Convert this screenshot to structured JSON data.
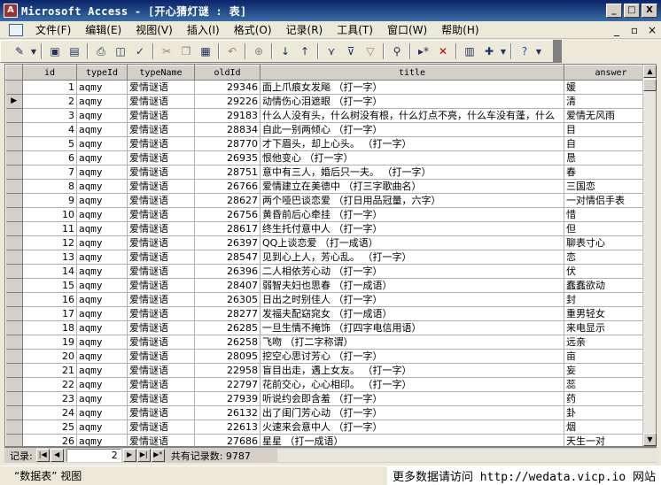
{
  "window": {
    "title": "Microsoft Access - [开心猜灯谜 : 表]",
    "app_icon": "access-key-icon",
    "controls": [
      "_",
      "□",
      "X"
    ]
  },
  "menu": {
    "items": [
      "文件(F)",
      "编辑(E)",
      "视图(V)",
      "插入(I)",
      "格式(O)",
      "记录(R)",
      "工具(T)",
      "窗口(W)",
      "帮助(H)"
    ],
    "doc_controls": [
      "_",
      "▫",
      "×"
    ]
  },
  "toolbar": {
    "icons": [
      "view-icon",
      "save-icon",
      "db-window-icon",
      "print-icon",
      "preview-icon",
      "spell-icon",
      "cut-icon",
      "copy-icon",
      "paste-icon",
      "undo-icon",
      "hyperlink-icon",
      "sort-asc-icon",
      "sort-desc-icon",
      "filter-selection-icon",
      "filter-form-icon",
      "apply-filter-icon",
      "find-icon",
      "new-record-icon",
      "delete-record-icon",
      "database-window-icon",
      "new-object-icon",
      "help-icon"
    ]
  },
  "table": {
    "columns": [
      "id",
      "typeId",
      "typeName",
      "oldId",
      "title",
      "answer"
    ],
    "current_row": 2,
    "rows": [
      [
        "1",
        "aqmy",
        "爱情谜语",
        "29346",
        "面上爪痕女发飚 （打一字）",
        "媛"
      ],
      [
        "2",
        "aqmy",
        "爱情谜语",
        "29226",
        "动情伤心泪遮眼 （打一字）",
        "清"
      ],
      [
        "3",
        "aqmy",
        "爱情谜语",
        "29183",
        "什么人没有头，什么树没有根，什么灯点不亮，什么车没有蓬，什么",
        "爱情无风雨"
      ],
      [
        "4",
        "aqmy",
        "爱情谜语",
        "28834",
        "自此一别两倾心 （打一字）",
        "目"
      ],
      [
        "5",
        "aqmy",
        "爱情谜语",
        "28770",
        "才下眉头，却上心头。 （打一字）",
        "自"
      ],
      [
        "6",
        "aqmy",
        "爱情谜语",
        "26935",
        "恨他变心 （打一字）",
        "恳"
      ],
      [
        "7",
        "aqmy",
        "爱情谜语",
        "28751",
        "意中有三人，婚后只一夫。 （打一字）",
        "春"
      ],
      [
        "8",
        "aqmy",
        "爱情谜语",
        "26766",
        "爱情建立在美德中 （打三字歌曲名）",
        "三国恋"
      ],
      [
        "9",
        "aqmy",
        "爱情谜语",
        "28627",
        "两个哑巴谈恋爱 （打日用品冠量，六字）",
        "一对情侣手表"
      ],
      [
        "10",
        "aqmy",
        "爱情谜语",
        "26756",
        "黄昏前后心牵挂 （打一字）",
        "惜"
      ],
      [
        "11",
        "aqmy",
        "爱情谜语",
        "28617",
        "终生托付意中人 （打一字）",
        "但"
      ],
      [
        "12",
        "aqmy",
        "爱情谜语",
        "26397",
        "QQ上谈恋爱 （打一成语）",
        "聊表寸心"
      ],
      [
        "13",
        "aqmy",
        "爱情谜语",
        "28547",
        "见到心上人，芳心乱。 （打一字）",
        "恋"
      ],
      [
        "14",
        "aqmy",
        "爱情谜语",
        "26396",
        "二人相依芳心动 （打一字）",
        "伏"
      ],
      [
        "15",
        "aqmy",
        "爱情谜语",
        "28407",
        "弱智夫妇也思春 （打一成语）",
        "蠢蠢欲动"
      ],
      [
        "16",
        "aqmy",
        "爱情谜语",
        "26305",
        "日出之时别佳人 （打一字）",
        "封"
      ],
      [
        "17",
        "aqmy",
        "爱情谜语",
        "28277",
        "发福夫配窈窕女 （打一成语）",
        "重男轻女"
      ],
      [
        "18",
        "aqmy",
        "爱情谜语",
        "26285",
        "一旦生情不掩饰 （打四字电信用语）",
        "来电显示"
      ],
      [
        "19",
        "aqmy",
        "爱情谜语",
        "26258",
        "飞吻 （打二字称谓）",
        "远亲"
      ],
      [
        "20",
        "aqmy",
        "爱情谜语",
        "28095",
        "挖空心思讨芳心 （打一字）",
        "亩"
      ],
      [
        "21",
        "aqmy",
        "爱情谜语",
        "22958",
        "盲目出走，遇上女友。 （打一字）",
        "妄"
      ],
      [
        "22",
        "aqmy",
        "爱情谜语",
        "22797",
        "花前交心，心心相印。 （打一字）",
        "蕊"
      ],
      [
        "23",
        "aqmy",
        "爱情谜语",
        "27939",
        "听说约会即含羞 （打一字）",
        "药"
      ],
      [
        "24",
        "aqmy",
        "爱情谜语",
        "26132",
        "出了闺门芳心动 （打一字）",
        "卦"
      ],
      [
        "25",
        "aqmy",
        "爱情谜语",
        "22613",
        "火速来会意中人 （打一字）",
        "烟"
      ],
      [
        "26",
        "aqmy",
        "爱情谜语",
        "27686",
        "星星 （打一成语）",
        "天生一对"
      ]
    ]
  },
  "navigator": {
    "label": "记录:",
    "current": "2",
    "total_label": "共有记录数: 9787",
    "buttons": [
      "|◀",
      "◀",
      "▶",
      "▶|",
      "▶*"
    ]
  },
  "status": {
    "text": "“数据表” 视图",
    "watermark": "更多数据请访问 http://wedata.vicp.io 网站"
  }
}
